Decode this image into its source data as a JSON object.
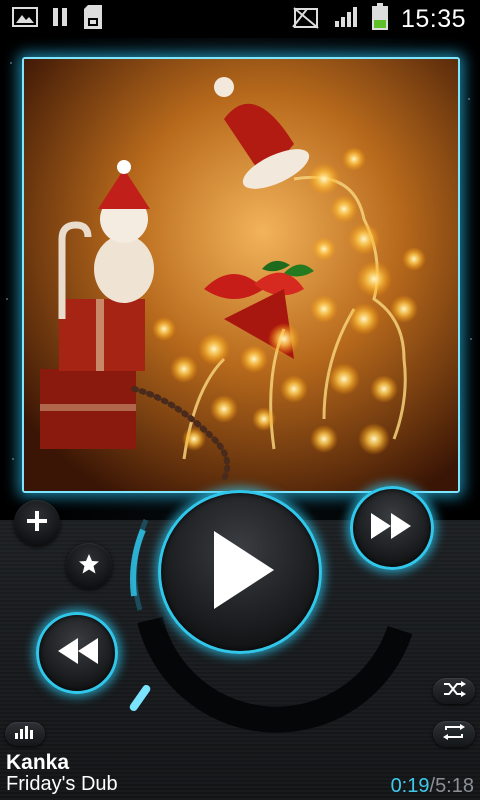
{
  "status_bar": {
    "time": "15:35",
    "left_icons": [
      "gallery-icon",
      "pause-icon",
      "sd-card-icon"
    ],
    "right_icons": [
      "no-signal-icon",
      "signal-bars-icon",
      "battery-icon"
    ]
  },
  "album_art": {
    "description_icon": "christmas-reindeer-lights-artwork"
  },
  "controls": {
    "add_icon": "plus-icon",
    "favorite_icon": "star-icon",
    "rewind_icon": "rewind-icon",
    "play_icon": "play-icon",
    "fast_forward_icon": "fast-forward-icon",
    "shuffle_icon": "shuffle-icon",
    "repeat_icon": "repeat-icon",
    "equalizer_icon": "equalizer-icon",
    "progress_fraction": 0.061
  },
  "track": {
    "title": "Kanka",
    "album": "Friday's Dub"
  },
  "time": {
    "current": "0:19",
    "separator": "/",
    "total": "5:18"
  },
  "colors": {
    "accent": "#31c7ea",
    "background": "#000000"
  }
}
